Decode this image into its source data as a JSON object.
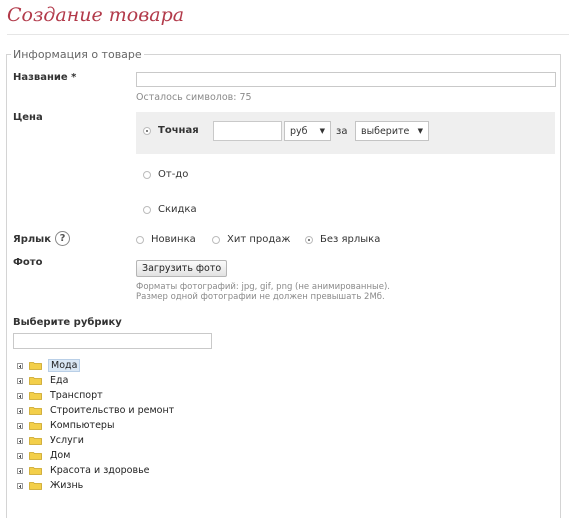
{
  "page_title": "Создание товара",
  "section_legend": "Информация о товаре",
  "name": {
    "label": "Название *",
    "value": "",
    "remaining_text": "Осталось символов: 75"
  },
  "price": {
    "label": "Цена",
    "exact_label": "Точная",
    "exact_value": "",
    "currency": "руб",
    "per_label": "за",
    "unit_placeholder": "выберите",
    "range_label": "От-до",
    "discount_label": "Скидка",
    "selected": "exact"
  },
  "tag": {
    "label": "Ярлык",
    "help": "?",
    "options": [
      "Новинка",
      "Хит продаж",
      "Без ярлыка"
    ],
    "selected": "Без ярлыка"
  },
  "photo": {
    "label": "Фото",
    "button": "Загрузить фото",
    "formats": "Форматы фотографий: jpg, gif, png (не анимированные).",
    "size": "Размер одной фотографии не должен превышать 2Мб."
  },
  "category": {
    "label": "Выберите рубрику",
    "search_value": "",
    "items": [
      "Мода",
      "Еда",
      "Транспорт",
      "Строительство и ремонт",
      "Компьютеры",
      "Услуги",
      "Дом",
      "Красота и здоровье",
      "Жизнь"
    ],
    "selected": "Мода"
  },
  "icons": {
    "folder": "folder-icon",
    "expand": "plus-expand-icon"
  },
  "colors": {
    "title": "#b23a4a",
    "folder": "#f3cf4a",
    "selected_bg": "#dbe8f5"
  }
}
